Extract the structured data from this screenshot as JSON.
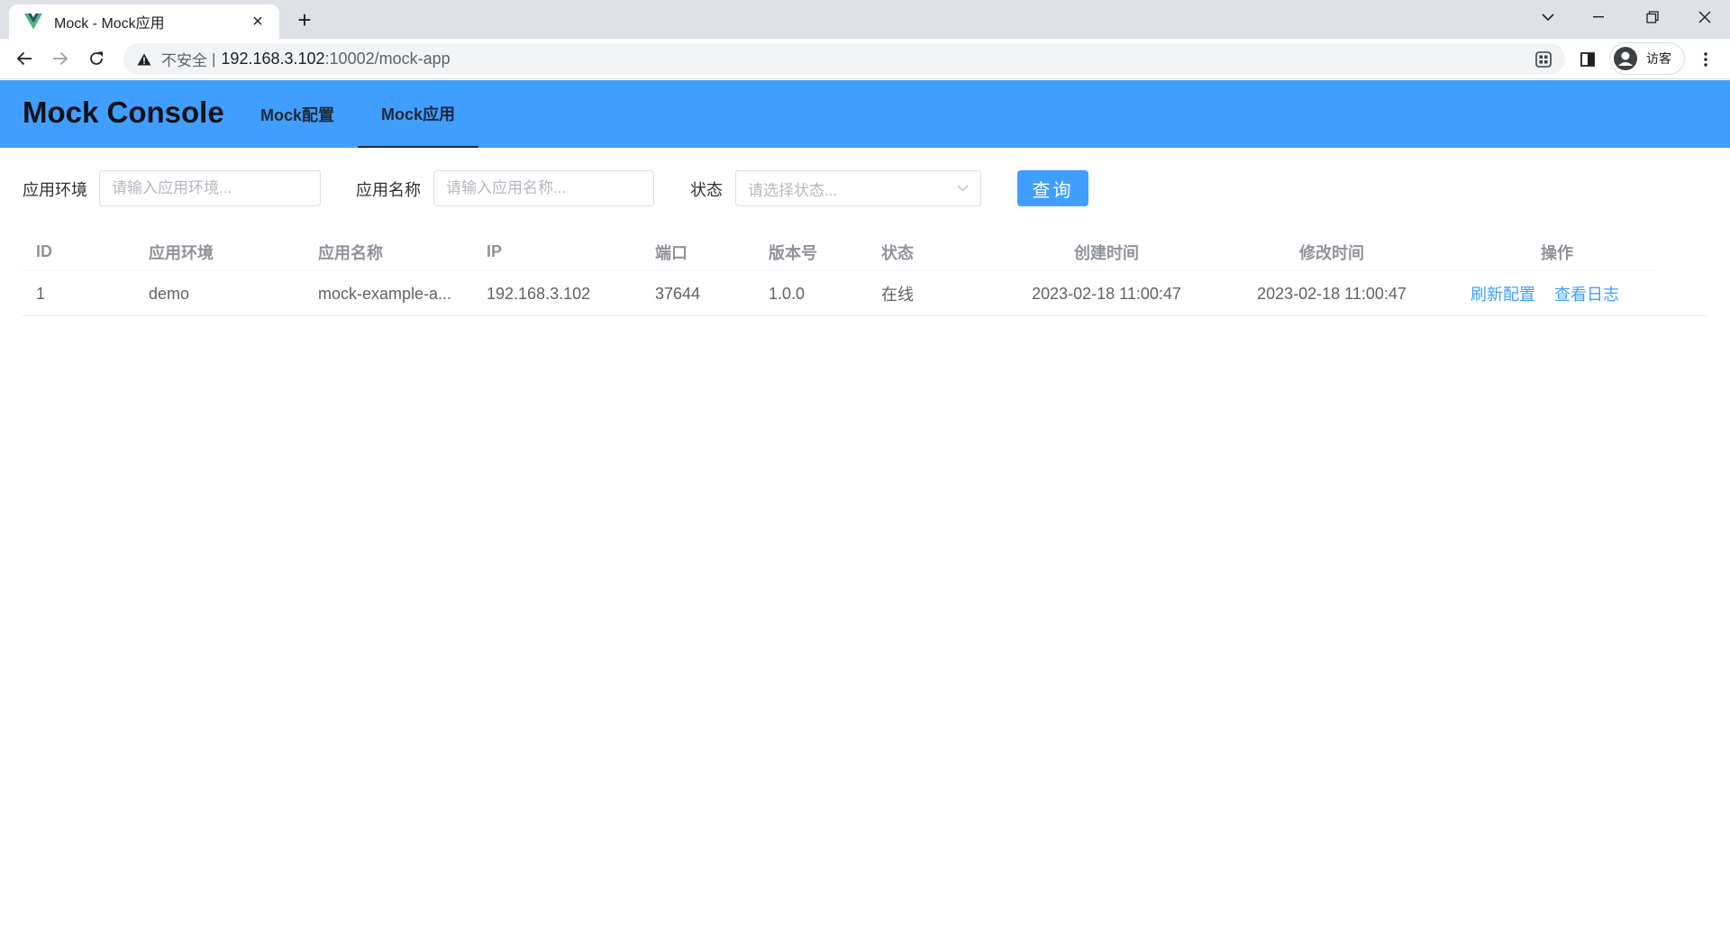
{
  "browser": {
    "tab_title": "Mock - Mock应用",
    "tab_close": "×",
    "new_tab": "+",
    "address": {
      "insecure_label": "不安全",
      "separator": "|",
      "host": "192.168.3.102",
      "path": ":10002/mock-app"
    },
    "profile_label": "访客"
  },
  "app": {
    "brand": "Mock Console",
    "nav": [
      {
        "label": "Mock配置",
        "active": false
      },
      {
        "label": "Mock应用",
        "active": true
      }
    ],
    "accent_color": "#409eff"
  },
  "filters": {
    "env_label": "应用环境",
    "env_placeholder": "请输入应用环境...",
    "name_label": "应用名称",
    "name_placeholder": "请输入应用名称...",
    "status_label": "状态",
    "status_placeholder": "请选择状态...",
    "query_button": "查询"
  },
  "table": {
    "headers": [
      "ID",
      "应用环境",
      "应用名称",
      "IP",
      "端口",
      "版本号",
      "状态",
      "创建时间",
      "修改时间",
      "操作"
    ],
    "rows": [
      {
        "id": "1",
        "env": "demo",
        "name": "mock-example-a...",
        "ip": "192.168.3.102",
        "port": "37644",
        "version": "1.0.0",
        "status": "在线",
        "created": "2023-02-18 11:00:47",
        "modified": "2023-02-18 11:00:47",
        "actions": [
          "刷新配置",
          "查看日志"
        ]
      }
    ]
  }
}
